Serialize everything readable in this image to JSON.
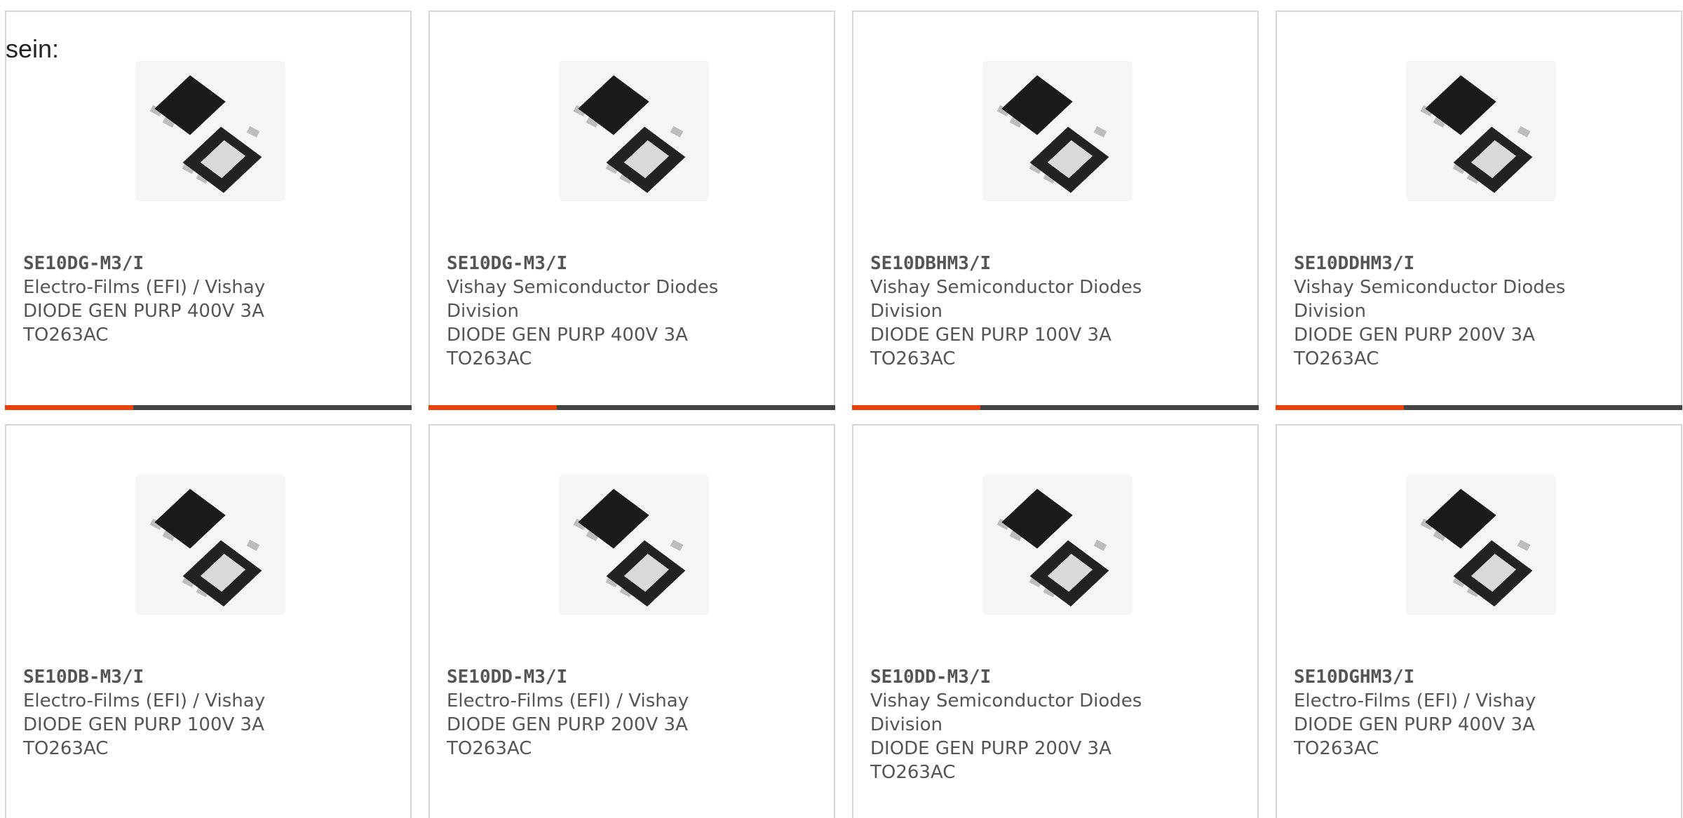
{
  "intro_text": "sein:",
  "colors": {
    "accent": "#e8410c",
    "bar": "#444444",
    "border": "#d7d7d7",
    "text": "#555555"
  },
  "image_icon": "product-image-icon",
  "cards": [
    {
      "part_number": "SE10DG-M3/I",
      "lines": [
        "Electro-Films (EFI) / Vishay",
        "DIODE GEN PURP 400V 3A",
        "TO263AC"
      ]
    },
    {
      "part_number": "SE10DG-M3/I",
      "lines": [
        "Vishay Semiconductor Diodes",
        "Division",
        "DIODE GEN PURP 400V 3A",
        "TO263AC"
      ]
    },
    {
      "part_number": "SE10DBHM3/I",
      "lines": [
        "Vishay Semiconductor Diodes",
        "Division",
        "DIODE GEN PURP 100V 3A",
        "TO263AC"
      ]
    },
    {
      "part_number": "SE10DDHM3/I",
      "lines": [
        "Vishay Semiconductor Diodes",
        "Division",
        "DIODE GEN PURP 200V 3A",
        "TO263AC"
      ]
    },
    {
      "part_number": "SE10DB-M3/I",
      "lines": [
        "Electro-Films (EFI) / Vishay",
        "DIODE GEN PURP 100V 3A",
        "TO263AC"
      ]
    },
    {
      "part_number": "SE10DD-M3/I",
      "lines": [
        "Electro-Films (EFI) / Vishay",
        "DIODE GEN PURP 200V 3A",
        "TO263AC"
      ]
    },
    {
      "part_number": "SE10DD-M3/I",
      "lines": [
        "Vishay Semiconductor Diodes",
        "Division",
        "DIODE GEN PURP 200V 3A",
        "TO263AC"
      ]
    },
    {
      "part_number": "SE10DGHM3/I",
      "lines": [
        "Electro-Films (EFI) / Vishay",
        "DIODE GEN PURP 400V 3A",
        "TO263AC"
      ]
    }
  ]
}
